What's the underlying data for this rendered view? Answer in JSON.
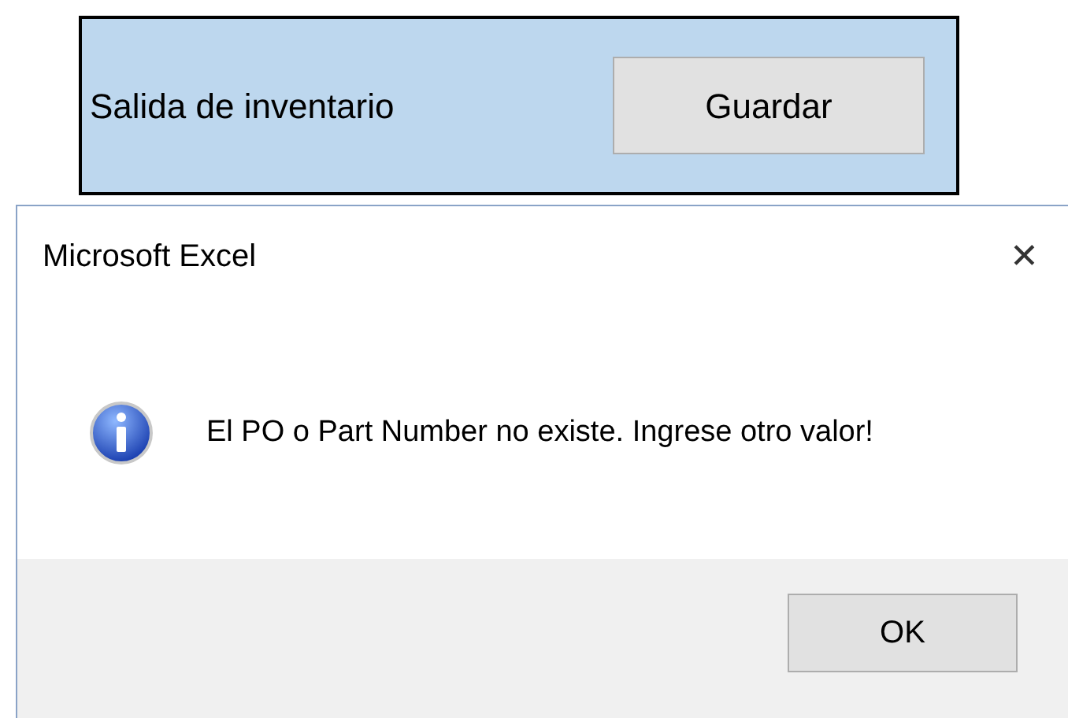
{
  "sheet_panel": {
    "label": "Salida de inventario",
    "button": "Guardar"
  },
  "dialog": {
    "title": "Microsoft Excel",
    "close": "✕",
    "message": "El PO o Part Number no existe. Ingrese otro valor!",
    "button": "OK"
  }
}
